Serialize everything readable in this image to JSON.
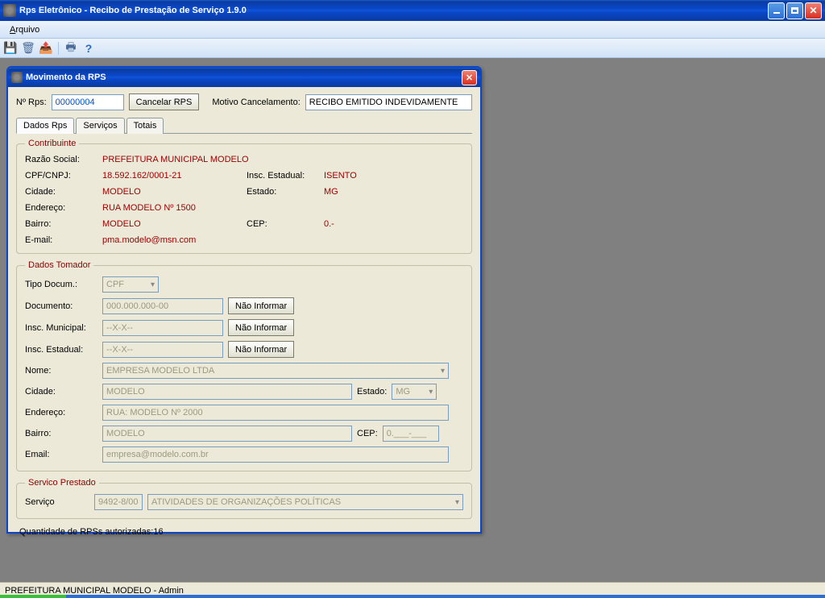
{
  "main_window": {
    "title": "Rps Eletrônico - Recibo de Prestação de Serviço 1.9.0"
  },
  "menubar": {
    "arquivo": "Arquivo"
  },
  "dialog": {
    "title": "Movimento da RPS",
    "top": {
      "n_rps_label": "Nº Rps:",
      "n_rps_value": "00000004",
      "cancel_btn": "Cancelar RPS",
      "motivo_label": "Motivo Cancelamento:",
      "motivo_value": "RECIBO EMITIDO INDEVIDAMENTE"
    },
    "tabs": {
      "dados_rps": "Dados Rps",
      "servicos": "Serviços",
      "totais": "Totais"
    },
    "contribuinte": {
      "legend": "Contribuinte",
      "razao_lbl": "Razão Social:",
      "razao_val": "PREFEITURA MUNICIPAL MODELO",
      "cpfcnpj_lbl": "CPF/CNPJ:",
      "cpfcnpj_val": "18.592.162/0001-21",
      "inscest_lbl": "Insc. Estadual:",
      "inscest_val": "ISENTO",
      "cidade_lbl": "Cidade:",
      "cidade_val": "MODELO",
      "estado_lbl": "Estado:",
      "estado_val": "MG",
      "endereco_lbl": "Endereço:",
      "endereco_val": "RUA MODELO Nº 1500",
      "bairro_lbl": "Bairro:",
      "bairro_val": "MODELO",
      "cep_lbl": "CEP:",
      "cep_val": "0.-",
      "email_lbl": "E-mail:",
      "email_val": "pma.modelo@msn.com"
    },
    "tomador": {
      "legend": "Dados Tomador",
      "tipodoc_lbl": "Tipo Docum.:",
      "tipodoc_val": "CPF",
      "documento_lbl": "Documento:",
      "documento_val": "000.000.000-00",
      "nao_informar": "Não Informar",
      "inscmun_lbl": "Insc. Municipal:",
      "inscmun_val": "--X-X--",
      "inscest_lbl": "Insc. Estadual:",
      "inscest_val": "--X-X--",
      "nome_lbl": "Nome:",
      "nome_val": "EMPRESA MODELO LTDA",
      "cidade_lbl": "Cidade:",
      "cidade_val": "MODELO",
      "estado_lbl": "Estado:",
      "estado_val": "MG",
      "endereco_lbl": "Endereço:",
      "endereco_val": "RUA: MODELO Nº 2000",
      "bairro_lbl": "Bairro:",
      "bairro_val": "MODELO",
      "cep_lbl": "CEP:",
      "cep_val": "0.___-___",
      "email_lbl": "Email:",
      "email_val": "empresa@modelo.com.br"
    },
    "servico_prestado": {
      "legend": "Servico Prestado",
      "servico_lbl": "Serviço",
      "codigo": "9492-8/00",
      "descricao": "ATIVIDADES DE ORGANIZAÇÕES POLÍTICAS"
    },
    "footer": "Quantidade de RPSs autorizadas:16"
  },
  "statusbar": "PREFEITURA MUNICIPAL MODELO - Admin"
}
